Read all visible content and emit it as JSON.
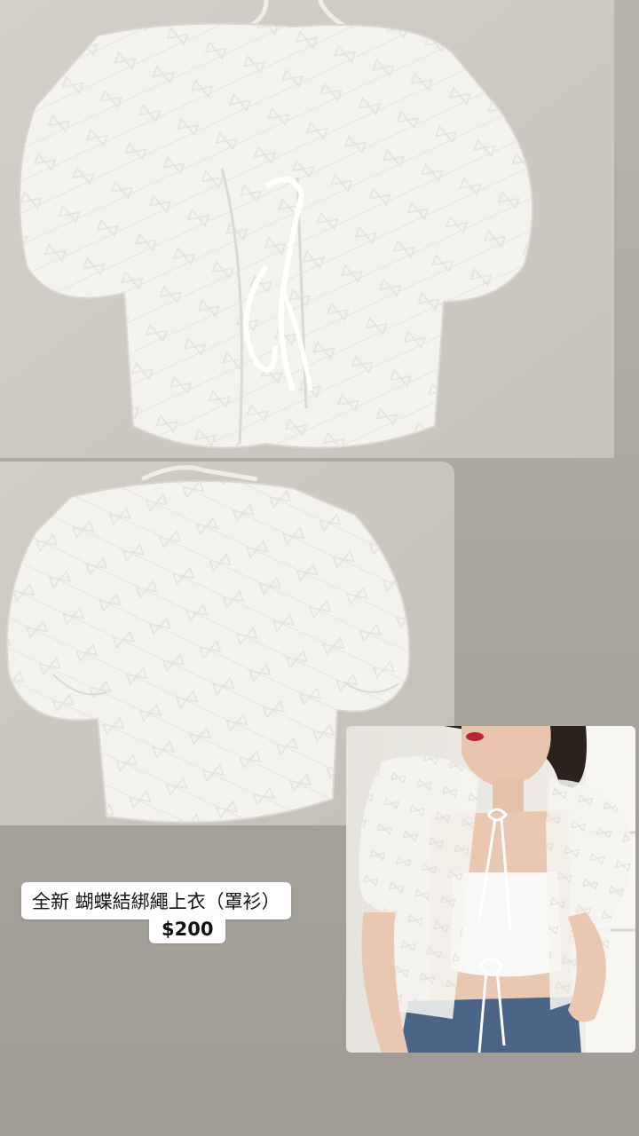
{
  "story": {
    "caption": "全新 蝴蝶結綁繩上衣（罩衫）",
    "price": "$200"
  },
  "photos": [
    {
      "subject": "hanger-front-tied"
    },
    {
      "subject": "hanger-back"
    },
    {
      "subject": "model-wearing"
    }
  ],
  "colors": {
    "background": "#aaa69f",
    "wall": "#dcd9d2",
    "garment": "#f4f3ee",
    "denim": "#4b6588"
  }
}
